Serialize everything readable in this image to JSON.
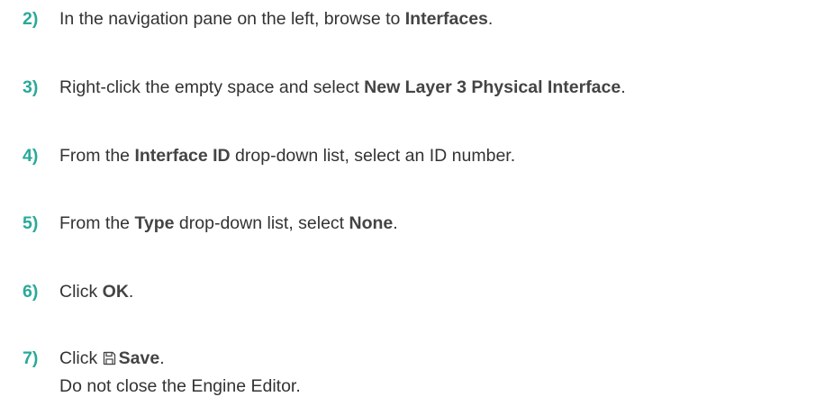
{
  "steps": [
    {
      "number": "2)",
      "parts": [
        {
          "text": "In the navigation pane on the left, browse to ",
          "bold": false
        },
        {
          "text": "Interfaces",
          "bold": true
        },
        {
          "text": ".",
          "bold": false
        }
      ]
    },
    {
      "number": "3)",
      "parts": [
        {
          "text": "Right-click the empty space and select ",
          "bold": false
        },
        {
          "text": "New Layer 3 Physical Interface",
          "bold": true
        },
        {
          "text": ".",
          "bold": false
        }
      ]
    },
    {
      "number": "4)",
      "parts": [
        {
          "text": "From the ",
          "bold": false
        },
        {
          "text": "Interface ID",
          "bold": true
        },
        {
          "text": " drop-down list, select an ID number.",
          "bold": false
        }
      ]
    },
    {
      "number": "5)",
      "parts": [
        {
          "text": "From the ",
          "bold": false
        },
        {
          "text": "Type",
          "bold": true
        },
        {
          "text": " drop-down list, select ",
          "bold": false
        },
        {
          "text": "None",
          "bold": true
        },
        {
          "text": ".",
          "bold": false
        }
      ]
    },
    {
      "number": "6)",
      "parts": [
        {
          "text": "Click ",
          "bold": false
        },
        {
          "text": "OK",
          "bold": true
        },
        {
          "text": ".",
          "bold": false
        }
      ]
    },
    {
      "number": "7)",
      "parts": [
        {
          "text": "Click ",
          "bold": false
        },
        {
          "icon": "save-icon"
        },
        {
          "text": "Save",
          "bold": true
        },
        {
          "text": ".",
          "bold": false
        }
      ],
      "subtext": "Do not close the Engine Editor."
    }
  ],
  "colors": {
    "step_number": "#29a99a",
    "body_text": "#333333"
  }
}
